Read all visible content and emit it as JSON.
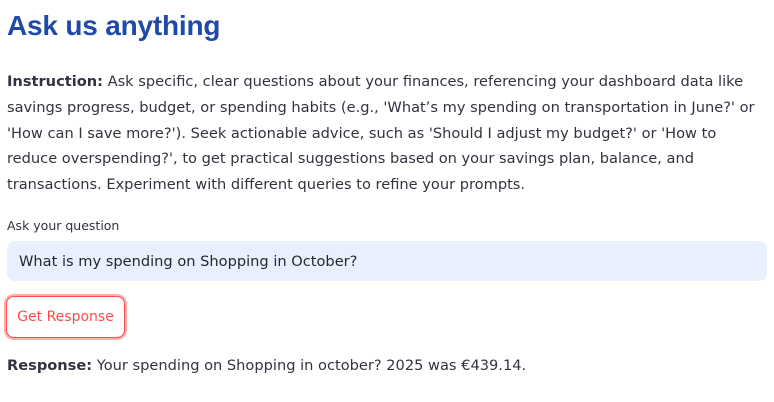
{
  "page": {
    "title": "Ask us anything"
  },
  "instruction": {
    "label": "Instruction:",
    "text": " Ask specific, clear questions about your finances, referencing your dashboard data like savings progress, budget, or spending habits (e.g., 'What’s my spending on transportation in June?' or 'How can I save more?'). Seek actionable advice, such as 'Should I adjust my budget?' or 'How to reduce overspending?', to get practical suggestions based on your savings plan, balance, and transactions. Experiment with different queries to refine your prompts."
  },
  "question": {
    "label": "Ask your question",
    "value": "What is my spending on Shopping in October?"
  },
  "button": {
    "label": "Get Response"
  },
  "response": {
    "label": "Response:",
    "text": " Your spending on Shopping in october? 2025 was €439.14."
  },
  "colors": {
    "title": "#1f4aa8",
    "text": "#31333f",
    "input_bg": "#e8f0fe",
    "button_accent": "#ff4b4b"
  }
}
